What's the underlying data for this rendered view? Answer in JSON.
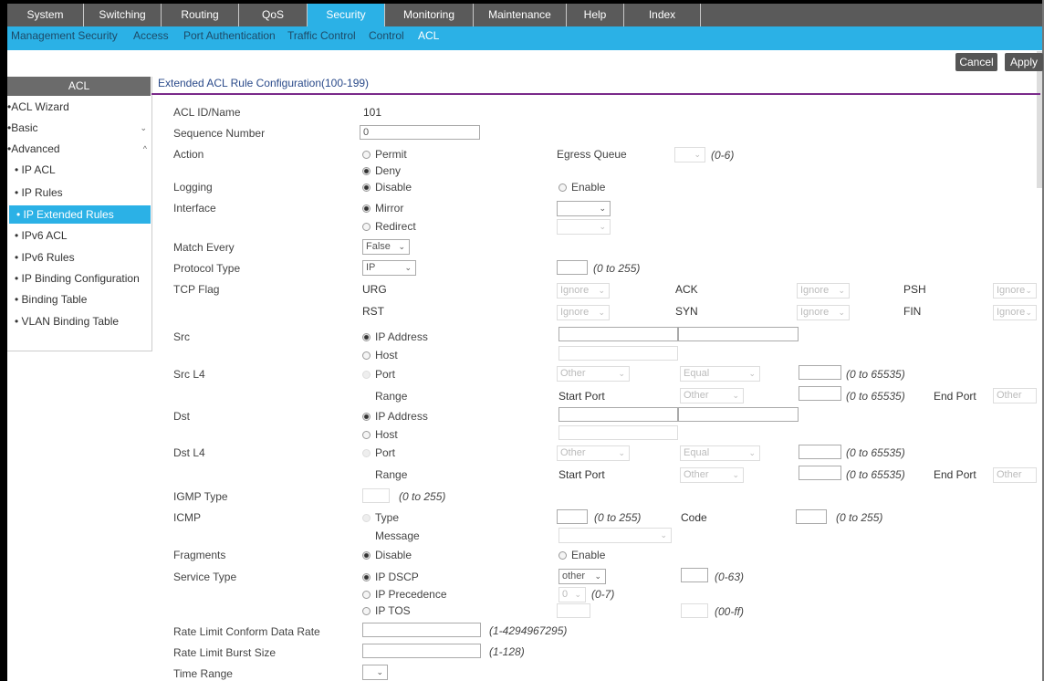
{
  "topnav": {
    "tabs": [
      "System",
      "Switching",
      "Routing",
      "QoS",
      "Security",
      "Monitoring",
      "Maintenance",
      "Help",
      "Index"
    ]
  },
  "subnav": {
    "items": [
      "Management Security",
      "Access",
      "Port Authentication",
      "Traffic Control",
      "Control",
      "ACL"
    ]
  },
  "toolbar": {
    "cancel": "Cancel",
    "apply": "Apply"
  },
  "sidebar": {
    "title": "ACL",
    "items": [
      "ACL Wizard",
      "Basic",
      "Advanced",
      "IP ACL",
      "IP Rules",
      "IP Extended Rules",
      "IPv6 ACL",
      "IPv6 Rules",
      "IP Binding Configuration",
      "Binding Table",
      "VLAN Binding Table"
    ]
  },
  "form": {
    "title": "Extended ACL Rule Configuration(100-199)",
    "acl_id_label": "ACL ID/Name",
    "acl_id_value": "101",
    "seq_label": "Sequence Number",
    "seq_value": "0",
    "action_label": "Action",
    "permit": "Permit",
    "deny": "Deny",
    "egress_label": "Egress Queue",
    "egress_range": "(0-6)",
    "logging_label": "Logging",
    "disable": "Disable",
    "enable": "Enable",
    "interface_label": "Interface",
    "mirror": "Mirror",
    "redirect": "Redirect",
    "match_label": "Match Every",
    "match_value": "False",
    "protocol_label": "Protocol Type",
    "protocol_value": "IP",
    "protocol_range": "(0 to 255)",
    "tcp_label": "TCP Flag",
    "urg": "URG",
    "ack": "ACK",
    "psh": "PSH",
    "rst": "RST",
    "syn": "SYN",
    "fin": "FIN",
    "ignore": "Ignore",
    "src_label": "Src",
    "ip_address": "IP Address",
    "host": "Host",
    "srcl4_label": "Src L4",
    "port": "Port",
    "range": "Range",
    "other": "Other",
    "equal": "Equal",
    "port_range": "(0 to 65535)",
    "start_port": "Start Port",
    "end_port": "End Port",
    "dst_label": "Dst",
    "dstl4_label": "Dst L4",
    "igmp_label": "IGMP Type",
    "range_255": "(0 to 255)",
    "icmp_label": "ICMP",
    "type": "Type",
    "code": "Code",
    "message": "Message",
    "frag_label": "Fragments",
    "service_label": "Service Type",
    "ip_dscp": "IP DSCP",
    "dscp_value": "other",
    "dscp_range": "(0-63)",
    "ip_precedence": "IP Precedence",
    "prec_value": "0",
    "prec_range": "(0-7)",
    "ip_tos": "IP TOS",
    "tos_range": "(00-ff)",
    "rate_conform_label": "Rate Limit Conform Data Rate",
    "rate_conform_range": "(1-4294967295)",
    "rate_burst_label": "Rate Limit Burst Size",
    "rate_burst_range": "(1-128)",
    "time_label": "Time Range"
  }
}
